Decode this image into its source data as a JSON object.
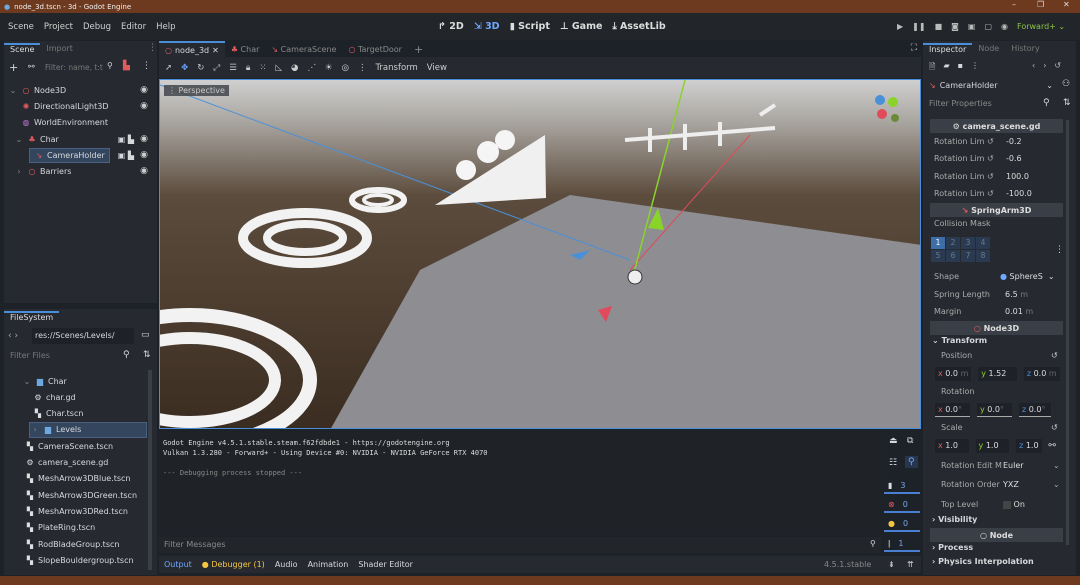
{
  "window": {
    "title": "node_3d.tscn - 3d - Godot Engine",
    "min": "–",
    "max": "❐",
    "close": "✕"
  },
  "menu": [
    "Scene",
    "Project",
    "Debug",
    "Editor",
    "Help"
  ],
  "workspaces": [
    "2D",
    "3D",
    "Script",
    "Game",
    "AssetLib"
  ],
  "run": {
    "renderer": "Forward+"
  },
  "scene_dock": {
    "tabs": [
      "Scene",
      "Import"
    ],
    "filter_placeholder": "Filter: name, t:t",
    "tree": [
      {
        "name": "Node3D",
        "color": "#e05c5c",
        "icon": "○"
      },
      {
        "name": "DirectionalLight3D",
        "color": "#e05c5c",
        "icon": "✺"
      },
      {
        "name": "WorldEnvironment",
        "color": "#c07ad6",
        "icon": "◍"
      },
      {
        "name": "Char",
        "color": "#e05c5c",
        "icon": "♣"
      },
      {
        "name": "CameraHolder",
        "color": "#e05c5c",
        "icon": "↘"
      },
      {
        "name": "Barriers",
        "color": "#e05c5c",
        "icon": "○"
      }
    ]
  },
  "filesystem": {
    "title": "FileSystem",
    "path": "res://Scenes/Levels/",
    "filter_placeholder": "Filter Files",
    "items": [
      {
        "name": "Char",
        "type": "folder"
      },
      {
        "name": "char.gd",
        "type": "script"
      },
      {
        "name": "Char.tscn",
        "type": "scene"
      },
      {
        "name": "Levels",
        "type": "folder"
      },
      {
        "name": "CameraScene.tscn",
        "type": "scene"
      },
      {
        "name": "camera_scene.gd",
        "type": "script"
      },
      {
        "name": "MeshArrow3DBlue.tscn",
        "type": "scene"
      },
      {
        "name": "MeshArrow3DGreen.tscn",
        "type": "scene"
      },
      {
        "name": "MeshArrow3DRed.tscn",
        "type": "scene"
      },
      {
        "name": "PlateRing.tscn",
        "type": "scene"
      },
      {
        "name": "RodBladeGroup.tscn",
        "type": "scene"
      },
      {
        "name": "SlopeBouldergroup.tscn",
        "type": "scene"
      }
    ]
  },
  "editor_tabs": [
    "node_3d",
    "Char",
    "CameraScene",
    "TargetDoor"
  ],
  "toolbar": {
    "transform": "Transform",
    "view": "View"
  },
  "viewport": {
    "label": "Perspective"
  },
  "output": {
    "lines": [
      "Godot Engine v4.5.1.stable.steam.f62fdbde1 - https://godotengine.org",
      "Vulkan 1.3.280 - Forward+ - Using Device #0: NVIDIA - NVIDIA GeForce RTX 4070",
      "",
      "--- Debugging process stopped ---"
    ],
    "filter_placeholder": "Filter Messages",
    "counts": {
      "messages": "3",
      "errors": "0",
      "warnings": "0",
      "info": "1"
    }
  },
  "bottom_tabs": [
    "Output",
    "Debugger (1)",
    "Audio",
    "Animation",
    "Shader Editor"
  ],
  "version": "4.5.1.stable",
  "inspector": {
    "tabs": [
      "Inspector",
      "Node",
      "History"
    ],
    "node": "CameraHolder",
    "filter_placeholder": "Filter Properties",
    "script_section": "camera_scene.gd",
    "rotation_limits": [
      {
        "label": "Rotation Lim",
        "value": "-0.2"
      },
      {
        "label": "Rotation Lim",
        "value": "-0.6"
      },
      {
        "label": "Rotation Lim",
        "value": "100.0"
      },
      {
        "label": "Rotation Lim",
        "value": "-100.0"
      }
    ],
    "springarm_section": "SpringArm3D",
    "collision_mask": "Collision Mask",
    "layers": [
      "1",
      "2",
      "3",
      "4",
      "5",
      "6",
      "7",
      "8"
    ],
    "shape": {
      "label": "Shape",
      "value": "SphereS"
    },
    "spring_length": {
      "label": "Spring Length",
      "value": "6.5",
      "unit": "m"
    },
    "margin": {
      "label": "Margin",
      "value": "0.01",
      "unit": "m"
    },
    "node3d_section": "Node3D",
    "transform": "Transform",
    "position": {
      "label": "Position",
      "x": "0.0",
      "y": "1.52",
      "z": "0.0",
      "unit": "m"
    },
    "rotation": {
      "label": "Rotation",
      "x": "0.0",
      "y": "0.0",
      "z": "0.0",
      "unit": "°"
    },
    "scale": {
      "label": "Scale",
      "x": "1.0",
      "y": "1.0",
      "z": "1.0"
    },
    "rotation_edit_mode": {
      "label": "Rotation Edit M",
      "value": "Euler"
    },
    "rotation_order": {
      "label": "Rotation Order",
      "value": "YXZ"
    },
    "top_level": {
      "label": "Top Level",
      "value": "On"
    },
    "visibility": "Visibility",
    "node_section": "Node",
    "process": "Process",
    "physics_interp": "Physics Interpolation"
  }
}
